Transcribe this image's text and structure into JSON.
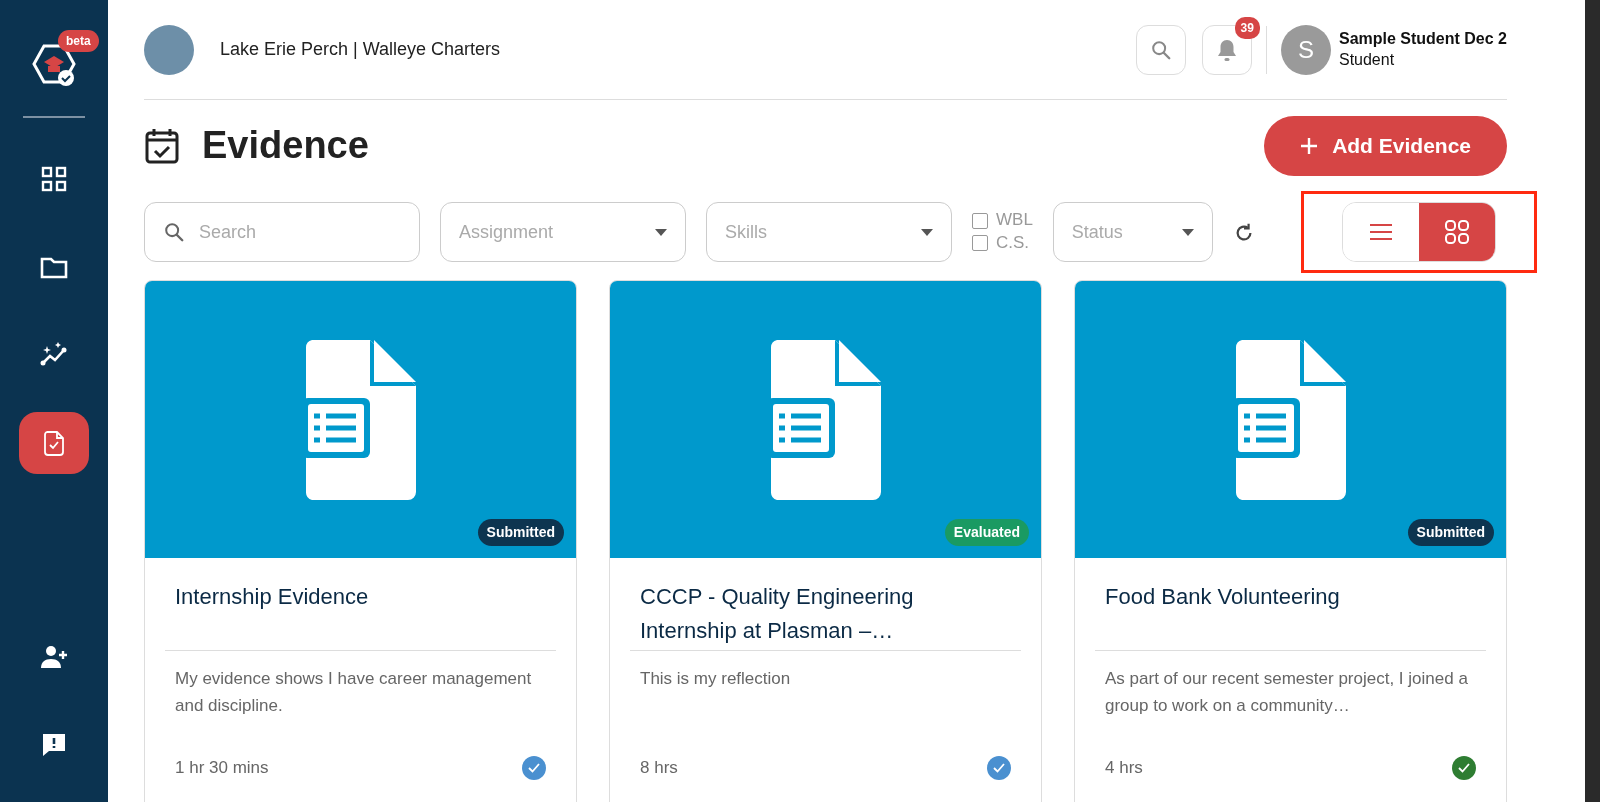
{
  "sidebar": {
    "logo_badge": "beta",
    "items": [
      {
        "kind": "dashboard",
        "selected": false
      },
      {
        "kind": "folder",
        "selected": false
      },
      {
        "kind": "analytics",
        "selected": false
      },
      {
        "kind": "evidence",
        "selected": true
      }
    ],
    "bottom_items": [
      {
        "kind": "add-person"
      },
      {
        "kind": "feedback"
      }
    ]
  },
  "header": {
    "org_name": "Lake Erie Perch | Walleye Charters",
    "notification_count": "39",
    "user": {
      "initial": "S",
      "name": "Sample Student Dec 2",
      "role": "Student"
    }
  },
  "page": {
    "title": "Evidence",
    "add_button": "Add Evidence"
  },
  "filters": {
    "search": {
      "placeholder": "Search"
    },
    "assignment": {
      "placeholder": "Assignment"
    },
    "skills": {
      "placeholder": "Skills"
    },
    "checkboxes": [
      {
        "label": "WBL",
        "checked": false
      },
      {
        "label": "C.S.",
        "checked": false
      }
    ],
    "status": {
      "placeholder": "Status"
    }
  },
  "view_toggle": {
    "highlighted": true,
    "options": [
      {
        "kind": "list",
        "selected": false
      },
      {
        "kind": "grid",
        "selected": true
      }
    ]
  },
  "cards": [
    {
      "kind": "submitted",
      "status": "Submitted",
      "title": "Internship Evidence",
      "description": "My evidence shows I have career management and discipline.",
      "duration": "1 hr 30 mins",
      "color": "#4a90d0"
    },
    {
      "kind": "evaluated",
      "status": "Evaluated",
      "title": "CCCP - Quality Engineering Internship at Plasman –…",
      "description": "This is my reflection",
      "duration": "8 hrs",
      "color": "#4a90d0"
    },
    {
      "kind": "submitted",
      "status": "Submitted",
      "title": "Food Bank Volunteering",
      "description": "As part of our recent semester project, I joined a group to work on a community…",
      "duration": "4 hrs",
      "color": "#2e7d32"
    }
  ]
}
